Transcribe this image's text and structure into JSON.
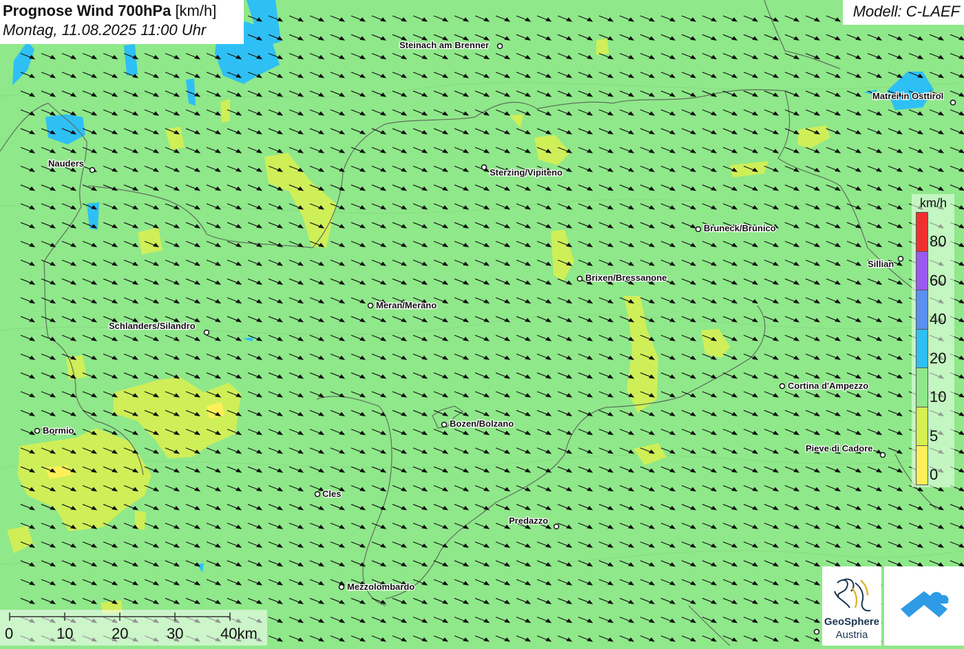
{
  "header": {
    "title_bold": "Prognose Wind 700hPa",
    "title_unit": "[km/h]",
    "datetime": "Montag, 11.08.2025 11:00 Uhr"
  },
  "model": {
    "label": "Modell: C-LAEF"
  },
  "legend": {
    "unit": "km/h",
    "classes": [
      {
        "label": "80",
        "color": "#f03030"
      },
      {
        "label": "60",
        "color": "#9b59f0"
      },
      {
        "label": "40",
        "color": "#5b8ff0"
      },
      {
        "label": "20",
        "color": "#2ec0f5"
      },
      {
        "label": "10",
        "color": "#8fe88a"
      },
      {
        "label": "5",
        "color": "#d6ef52"
      },
      {
        "label": "0",
        "color": "#ffef5a"
      }
    ]
  },
  "scale_bar": {
    "labels": [
      "0",
      "10",
      "20",
      "30",
      "40km"
    ]
  },
  "cities": [
    {
      "name": "Steinach am Brenner"
    },
    {
      "name": "Matrei in Osttirol"
    },
    {
      "name": "Nauders"
    },
    {
      "name": "Sterzing/Vipiteno"
    },
    {
      "name": "Bruneck/Brunico"
    },
    {
      "name": "Sillian"
    },
    {
      "name": "Brixen/Bressanone"
    },
    {
      "name": "Meran/Merano"
    },
    {
      "name": "Schlanders/Silandro"
    },
    {
      "name": "Cortina d'Ampezzo"
    },
    {
      "name": "Bormio"
    },
    {
      "name": "Bozen/Bolzano"
    },
    {
      "name": "Pieve di Cadore"
    },
    {
      "name": "Cles"
    },
    {
      "name": "Predazzo"
    },
    {
      "name": "Mezzolombardo"
    }
  ],
  "wind_field": {
    "direction": "west-northwest to east-southeast",
    "dominant_speed_class": "10"
  },
  "logos": {
    "geosphere_line1": "GeoSphere",
    "geosphere_line2": "Austria"
  }
}
